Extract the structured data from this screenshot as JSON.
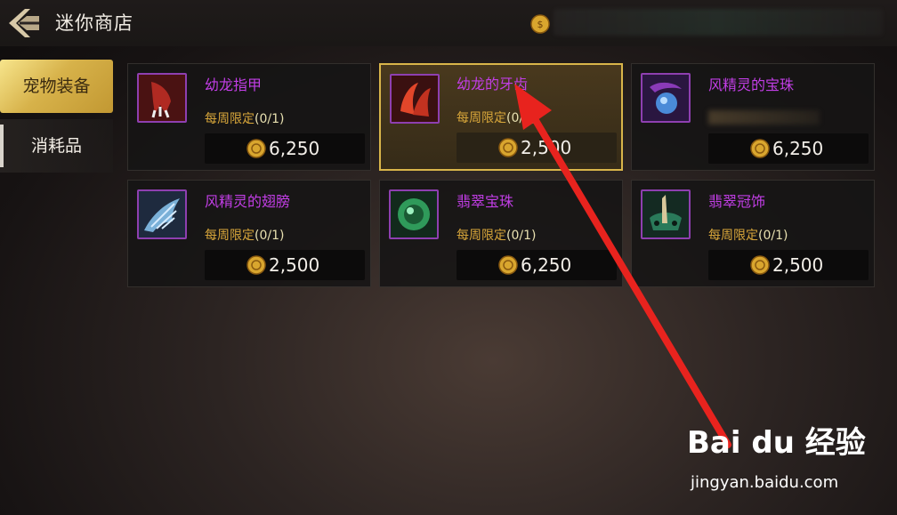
{
  "header": {
    "title": "迷你商店"
  },
  "sidebar": {
    "tabs": [
      {
        "label": "宠物装备",
        "active": true
      },
      {
        "label": "消耗品",
        "active": false
      }
    ]
  },
  "items": [
    {
      "name": "幼龙指甲",
      "limit_prefix": "每周限定",
      "limit_count": "(0/1)",
      "price": "6,250",
      "icon": "claw-icon"
    },
    {
      "name": "幼龙的牙齿",
      "limit_prefix": "每周限定",
      "limit_count": "(0/1)",
      "price": "2,500",
      "icon": "fang-icon",
      "selected": true
    },
    {
      "name": "风精灵的宝珠",
      "limit_prefix": "",
      "limit_count": "",
      "price": "6,250",
      "icon": "wind-orb-icon"
    },
    {
      "name": "风精灵的翅膀",
      "limit_prefix": "每周限定",
      "limit_count": "(0/1)",
      "price": "2,500",
      "icon": "wing-icon"
    },
    {
      "name": "翡翠宝珠",
      "limit_prefix": "每周限定",
      "limit_count": "(0/1)",
      "price": "6,250",
      "icon": "jade-orb-icon"
    },
    {
      "name": "翡翠冠饰",
      "limit_prefix": "每周限定",
      "limit_count": "(0/1)",
      "price": "2,500",
      "icon": "jade-crown-icon"
    }
  ],
  "watermark": {
    "logo": "Bai du 经验",
    "url": "jingyan.baidu.com"
  },
  "colors": {
    "accent_gold": "#d9b54a",
    "item_name_purple": "#c23ee6",
    "limit_orange": "#d8a63a"
  }
}
